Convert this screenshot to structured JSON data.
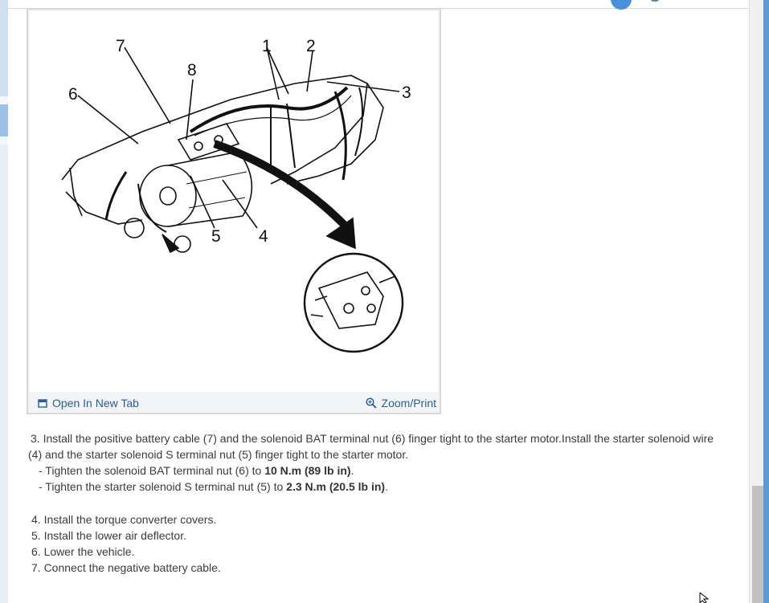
{
  "figure": {
    "callouts": [
      "1",
      "2",
      "3",
      "4",
      "5",
      "6",
      "7",
      "8"
    ],
    "open_tab_label": "Open In New Tab",
    "zoom_label": "Zoom/Print"
  },
  "steps": {
    "step3_line1": "3. Install the positive battery cable (7) and the solenoid BAT terminal nut (6) finger tight to the starter motor.Install the starter solenoid wire",
    "step3_line2": "(4) and the starter solenoid S terminal nut (5) finger tight to the starter motor.",
    "sub1_prefix": "-  Tighten the solenoid BAT terminal nut (6) to ",
    "sub1_bold": "10 N.m (89 lb in)",
    "sub1_suffix": ".",
    "sub2_prefix": "-  Tighten the starter solenoid S terminal nut (5) to ",
    "sub2_bold": "2.3 N.m (20.5 lb in)",
    "sub2_suffix": ".",
    "step4": "4. Install the torque converter covers.",
    "step5": "5. Install the lower air deflector.",
    "step6": "6. Lower the vehicle.",
    "step7": "7. Connect the negative battery cable."
  },
  "colors": {
    "link": "#2b5f96",
    "text": "#3b3b3b",
    "accent": "#4a90d9"
  }
}
